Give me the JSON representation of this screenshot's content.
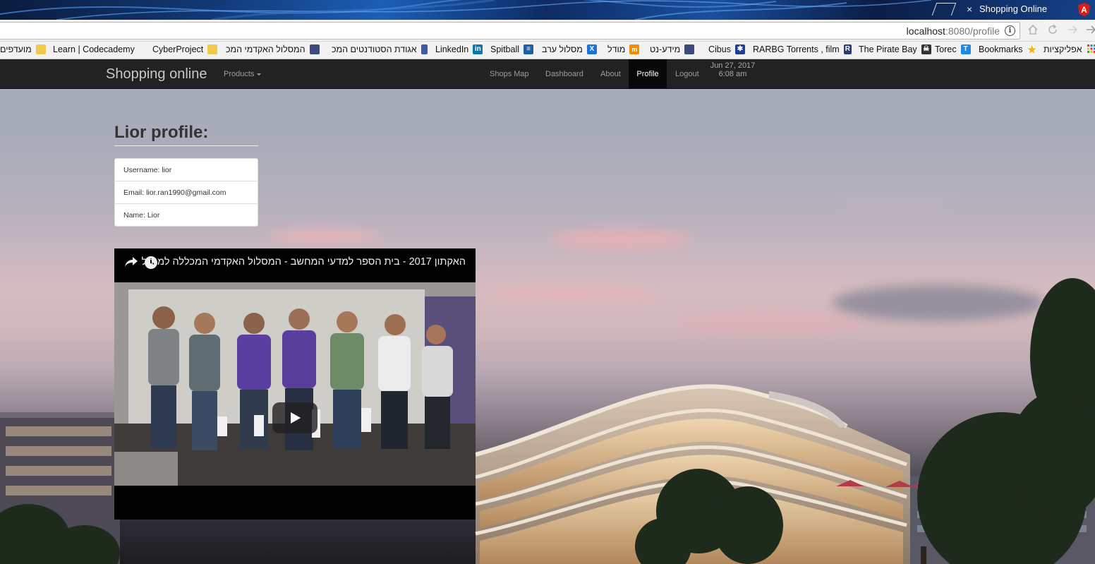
{
  "browser": {
    "tab_title": "Shopping Online",
    "tab_close": "×",
    "favicon": "A",
    "url_host": "localhost",
    "url_path": ":8080/profile",
    "info_icon": "i",
    "bookmarks": [
      {
        "label": "מועדפים",
        "icon": "folder-icon",
        "color": "#f2c94c"
      },
      {
        "label": "Learn | Codecademy",
        "icon": "folder-icon",
        "color": "#f2c94c"
      },
      {
        "label": "CyberProject",
        "icon": "folder-icon",
        "color": "#f2c94c"
      },
      {
        "label": "המסלול האקדמי המכ",
        "icon": "college-icon",
        "color": "#3d4a7a"
      },
      {
        "label": "אגודת הסטודנטים המכ",
        "icon": "student-union-icon",
        "color": "#4059a8"
      },
      {
        "label": "LinkedIn",
        "icon": "linkedin-icon",
        "color": "#0e76a8"
      },
      {
        "label": "Spitball",
        "icon": "spitball-icon",
        "color": "#1d5fa8"
      },
      {
        "label": "מסלול ערב",
        "icon": "x-icon",
        "color": "#1a73d8"
      },
      {
        "label": "מודל",
        "icon": "moodle-icon",
        "color": "#f28c00"
      },
      {
        "label": "מידע-נט",
        "icon": "medanet-icon",
        "color": "#3d4a7a"
      },
      {
        "label": "Cibus",
        "icon": "cibus-icon",
        "color": "#1c3f91"
      },
      {
        "label": "RARBG Torrents , film",
        "icon": "rarbg-icon",
        "color": "#2a3c6e"
      },
      {
        "label": "The Pirate Bay",
        "icon": "pirate-bay-icon",
        "color": "#333333"
      },
      {
        "label": "Torec",
        "icon": "torec-icon",
        "color": "#1e88e5"
      },
      {
        "label": "Bookmarks",
        "icon": "star-icon",
        "color": "#f5b400"
      },
      {
        "label": "אפליקציות",
        "icon": "apps-grid-icon",
        "color": "#e53935"
      }
    ]
  },
  "navbar": {
    "brand": "Shopping online",
    "products_label": "Products",
    "links": {
      "shops_map": "Shops Map",
      "dashboard": "Dashboard",
      "about": "About",
      "profile": "Profile",
      "logout": "Logout"
    },
    "date": "Jun 27, 2017",
    "time": "6:08 am"
  },
  "profile": {
    "title": "Lior profile:",
    "items": [
      {
        "label": "Username: lior"
      },
      {
        "label": "Email: lior.ran1990@gmail.com"
      },
      {
        "label": "Name: Lior"
      }
    ]
  },
  "video": {
    "title": "האקתון 2017 - בית הספר למדעי המחשב - המסלול האקדמי המכללה למנהל",
    "icons": [
      "clock-icon",
      "share-icon",
      "play-icon"
    ]
  }
}
